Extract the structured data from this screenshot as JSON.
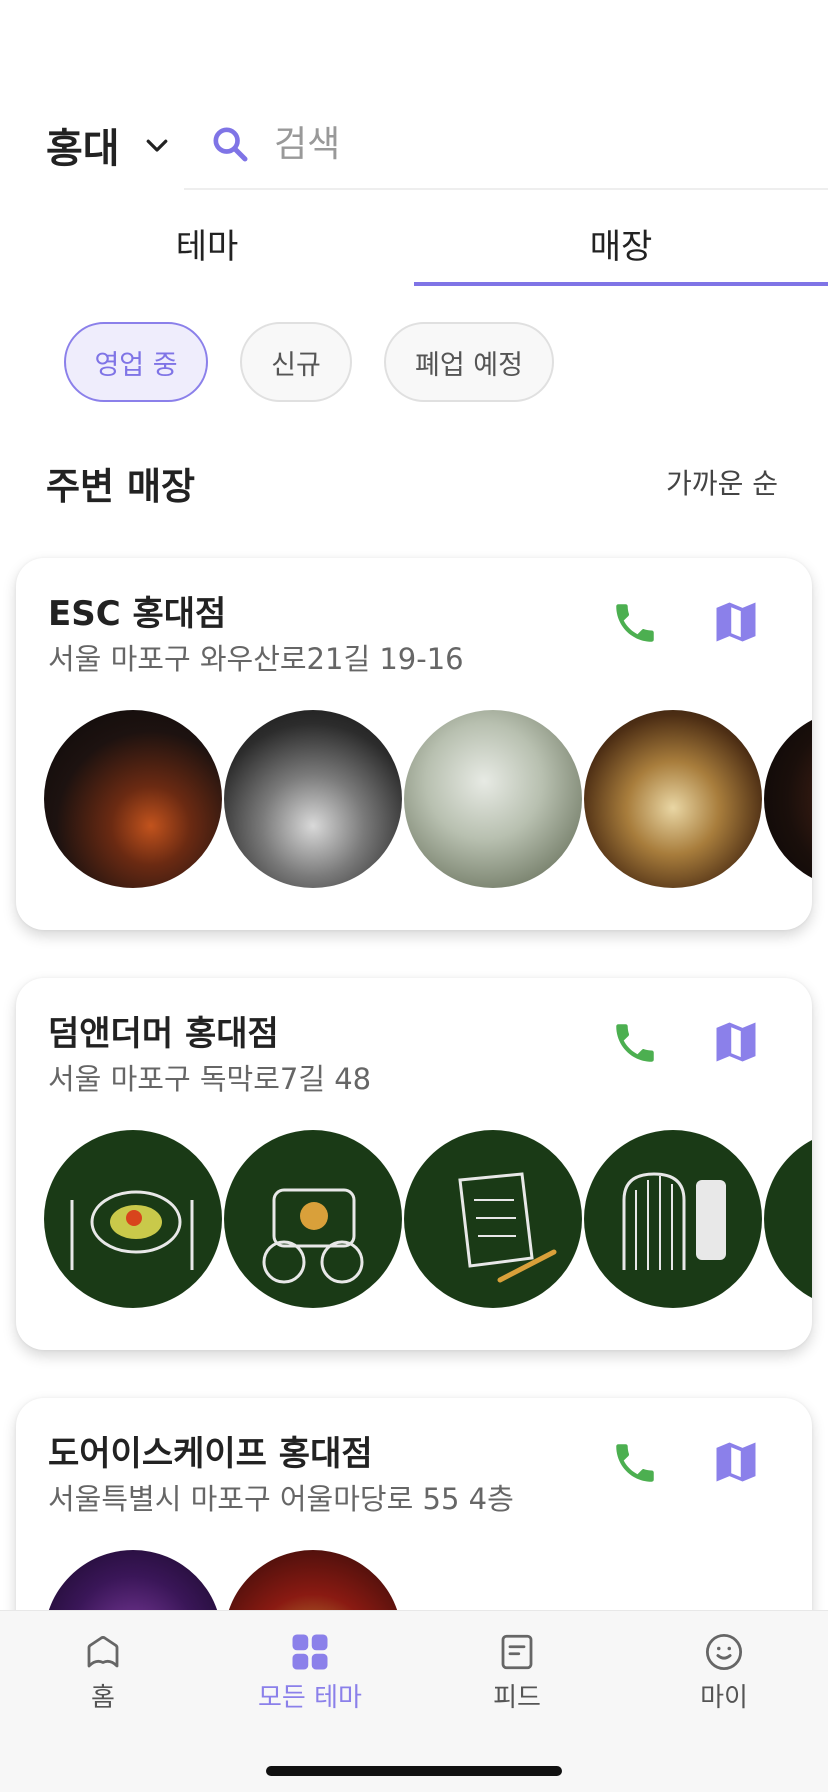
{
  "header": {
    "region": "홍대",
    "search_placeholder": "검색"
  },
  "tabs": [
    {
      "label": "테마",
      "active": false
    },
    {
      "label": "매장",
      "active": true
    }
  ],
  "filters": [
    {
      "label": "영업 중",
      "active": true
    },
    {
      "label": "신규",
      "active": false
    },
    {
      "label": "폐업 예정",
      "active": false
    }
  ],
  "section": {
    "title": "주변 매장",
    "sort_label": "가까운 순"
  },
  "stores": [
    {
      "name": "ESC 홍대점",
      "address": "서울 마포구 와우산로21길 19-16"
    },
    {
      "name": "덤앤더머 홍대점",
      "address": "서울 마포구 독막로7길 48"
    },
    {
      "name": "도어이스케이프 홍대점",
      "address": "서울특별시 마포구 어울마당로 55 4층"
    }
  ],
  "bottom_nav": [
    {
      "label": "홈",
      "icon": "home-icon",
      "active": false
    },
    {
      "label": "모든 테마",
      "icon": "grid-icon",
      "active": true
    },
    {
      "label": "피드",
      "icon": "feed-icon",
      "active": false
    },
    {
      "label": "마이",
      "icon": "smile-icon",
      "active": false
    }
  ],
  "colors": {
    "accent": "#7f74e6",
    "phone": "#4caf50",
    "map": "#8b80ea"
  }
}
